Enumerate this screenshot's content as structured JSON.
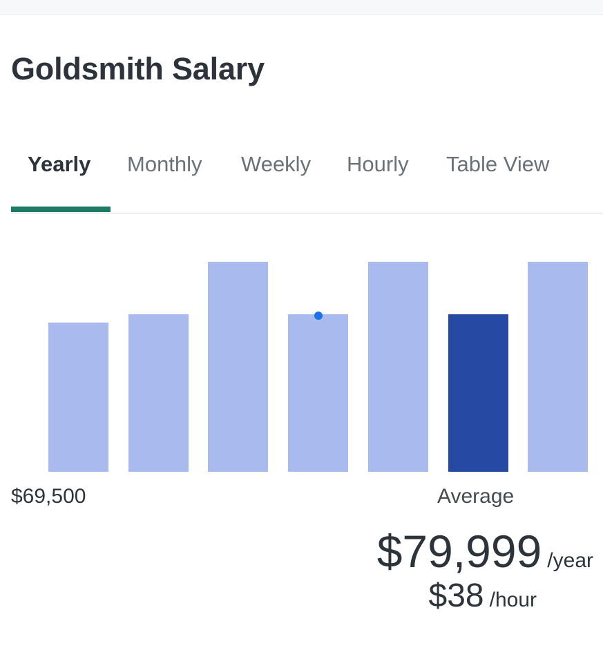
{
  "page": {
    "title": "Goldsmith Salary"
  },
  "tabs": [
    {
      "label": "Yearly",
      "active": true
    },
    {
      "label": "Monthly",
      "active": false
    },
    {
      "label": "Weekly",
      "active": false
    },
    {
      "label": "Hourly",
      "active": false
    },
    {
      "label": "Table View",
      "active": false
    }
  ],
  "colors": {
    "bar": "#a9bbee",
    "highlight_bar": "#264aa3",
    "active_tab_indicator": "#1d7a66",
    "marker": "#1a73e8"
  },
  "chart_data": {
    "type": "bar",
    "categories": [
      "",
      "",
      "",
      "",
      "",
      "",
      ""
    ],
    "values": [
      0.71,
      0.75,
      1.0,
      0.75,
      1.0,
      0.75,
      1.0
    ],
    "highlight_index": 5,
    "marker_index": 3,
    "min_label": "$69,500",
    "average_label": "Average"
  },
  "pay": {
    "yearly_amount": "$79,999",
    "yearly_unit": "/year",
    "hourly_amount": "$38",
    "hourly_unit": "/hour"
  }
}
